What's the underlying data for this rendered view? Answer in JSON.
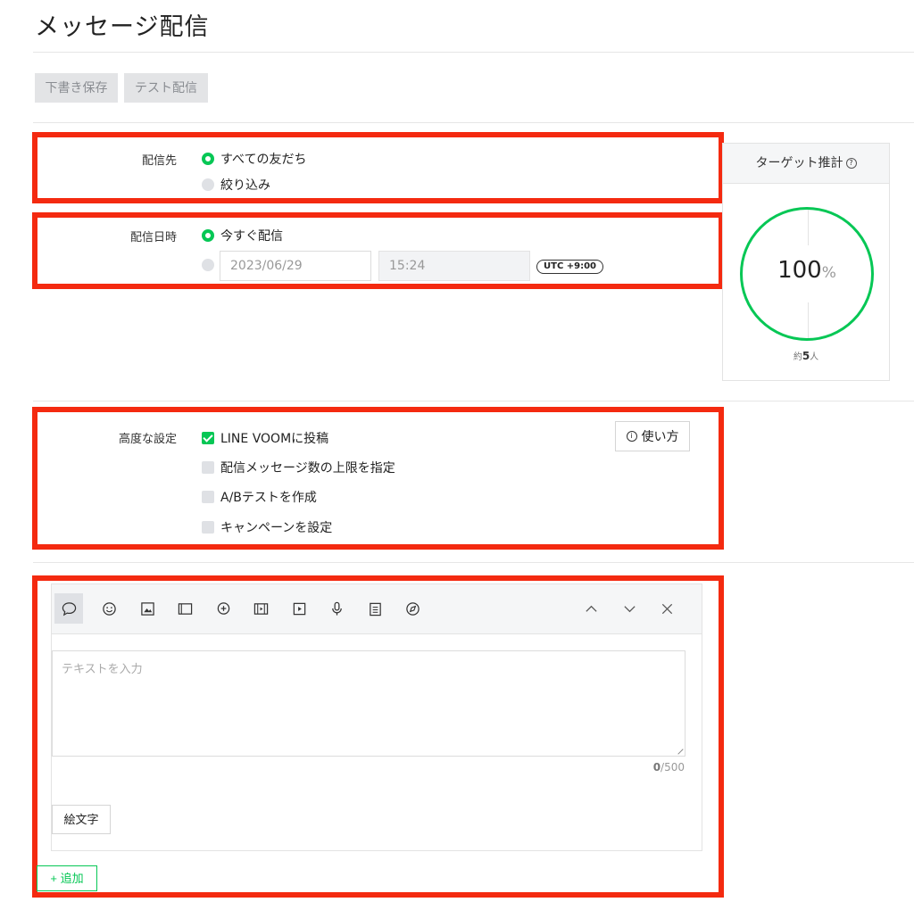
{
  "page": {
    "title": "メッセージ配信"
  },
  "actions": {
    "draft_save": "下書き保存",
    "test_send": "テスト配信"
  },
  "recipient": {
    "label": "配信先",
    "options": [
      {
        "label": "すべての友だち",
        "selected": true
      },
      {
        "label": "絞り込み",
        "selected": false
      }
    ]
  },
  "schedule": {
    "label": "配信日時",
    "now_label": "今すぐ配信",
    "date_placeholder": "2023/06/29",
    "time_placeholder": "15:24",
    "timezone": "UTC +9:00"
  },
  "target": {
    "title": "ターゲット推計",
    "help_icon": "?",
    "percent": "100",
    "percent_unit": "%",
    "approx_prefix": "約",
    "approx_count": "5",
    "approx_suffix": "人",
    "level": 1.0,
    "color": "#06c755"
  },
  "advanced": {
    "label": "高度な設定",
    "howto_label": "使い方",
    "info_icon": "i",
    "options": [
      {
        "label": "LINE VOOMに投稿",
        "checked": true
      },
      {
        "label": "配信メッセージ数の上限を指定",
        "checked": false
      },
      {
        "label": "A/Bテストを作成",
        "checked": false
      },
      {
        "label": "キャンペーンを設定",
        "checked": false
      }
    ]
  },
  "editor": {
    "toolbar_icons": [
      "speech-bubble-icon",
      "smiley-icon",
      "image-icon",
      "card-icon",
      "chat-plus-icon",
      "film-icon",
      "video-play-icon",
      "microphone-icon",
      "clipboard-icon",
      "compass-icon",
      "chevron-up-icon",
      "chevron-down-icon",
      "close-icon"
    ],
    "text_placeholder": "テキストを入力",
    "count_current": "0",
    "count_max": "/500",
    "emoji_button": "絵文字"
  },
  "add_button": {
    "icon": "+",
    "label": "追加"
  },
  "colors": {
    "accent": "#06c755",
    "highlight": "#f42a10"
  }
}
